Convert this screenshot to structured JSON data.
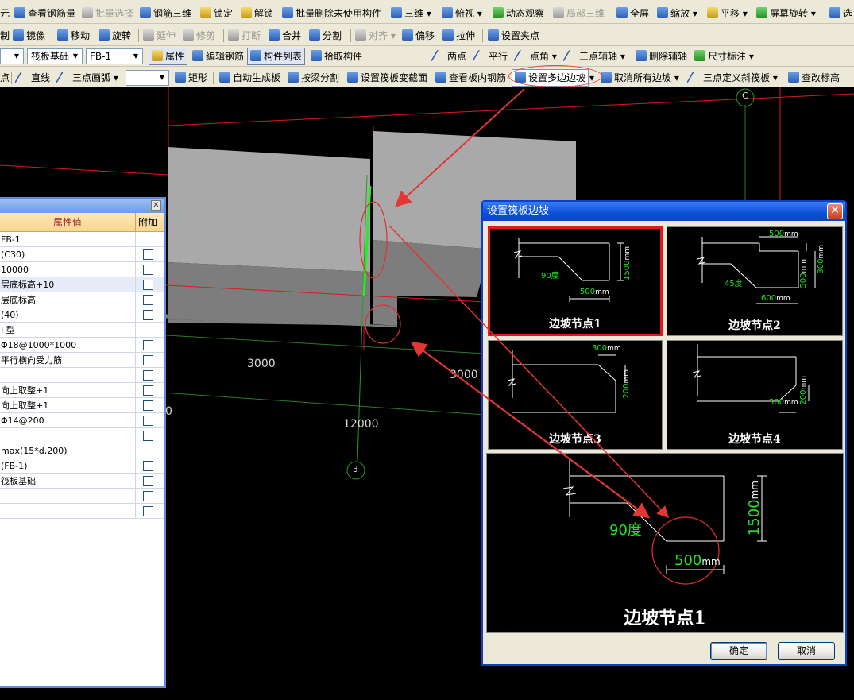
{
  "toolbar": {
    "row1": [
      "元",
      "查看钢筋量",
      "批量选择",
      "钢筋三维",
      "锁定",
      "解锁",
      "批量删除未使用构件",
      "三维",
      "俯视",
      "动态观察",
      "局部三维",
      "全屏",
      "缩放",
      "平移",
      "屏幕旋转",
      "选"
    ],
    "row2": [
      "制",
      "镜像",
      "移动",
      "旋转",
      "延伸",
      "修剪",
      "打断",
      "合并",
      "分割",
      "对齐",
      "偏移",
      "拉伸",
      "设置夹点"
    ],
    "row3": {
      "combo_type": "筏板基础",
      "combo_name": "FB-1",
      "items": [
        "属性",
        "编辑钢筋",
        "构件列表",
        "拾取构件",
        "两点",
        "平行",
        "点角",
        "三点辅轴",
        "删除辅轴",
        "尺寸标注"
      ]
    },
    "row4": [
      "点",
      "直线",
      "三点画弧",
      "矩形",
      "自动生成板",
      "按梁分割",
      "设置筏板变截面",
      "查看板内钢筋",
      "设置多边边坡",
      "取消所有边坡",
      "三点定义斜筏板",
      "查改标高"
    ]
  },
  "canvas": {
    "axis_c": "C",
    "axis_3": "3",
    "dim_3000_left": "3000",
    "dim_3000_right": "3000",
    "dim_12000": "12000",
    "dim_partial": "0"
  },
  "props": {
    "header_value": "属性值",
    "header_add": "附加",
    "rows": [
      {
        "v": "FB-1",
        "cb": false
      },
      {
        "v": "(C30)",
        "cb": true
      },
      {
        "v": "10000",
        "cb": true
      },
      {
        "v": "层底标高+10",
        "cb": true
      },
      {
        "v": "层底标高",
        "cb": true
      },
      {
        "v": "(40)",
        "cb": true
      },
      {
        "v": "I 型",
        "cb": false
      },
      {
        "v": "Φ18@1000*1000",
        "cb": true
      },
      {
        "v": "平行横向受力筋",
        "cb": true
      },
      {
        "v": "",
        "cb": true
      },
      {
        "v": "向上取整+1",
        "cb": true
      },
      {
        "v": "向上取整+1",
        "cb": true
      },
      {
        "v": "Φ14@200",
        "cb": true
      },
      {
        "v": "",
        "cb": true
      },
      {
        "v": "max(15*d,200)",
        "cb": false
      },
      {
        "v": "(FB-1)",
        "cb": true
      },
      {
        "v": "筏板基础",
        "cb": true
      },
      {
        "v": "",
        "cb": true
      },
      {
        "v": "",
        "cb": true
      }
    ]
  },
  "dialog": {
    "title": "设置筏板边坡",
    "options": [
      {
        "caption": "边坡节点1",
        "dim_h": "1500",
        "dim_w": "500",
        "angle": "90度",
        "unit": "mm"
      },
      {
        "caption": "边坡节点2",
        "dim_top": "500",
        "dim_h1": "300",
        "dim_h2": "500",
        "dim_w": "600",
        "angle": "45度",
        "unit": "mm"
      },
      {
        "caption": "边坡节点3",
        "dim_w": "300",
        "dim_h": "200",
        "unit": "mm"
      },
      {
        "caption": "边坡节点4",
        "dim_w": "300",
        "dim_h": "200",
        "unit": "mm"
      }
    ],
    "preview": {
      "caption": "边坡节点1",
      "angle": "90度",
      "dim_w": "500",
      "dim_h": "1500",
      "unit": "mm"
    },
    "ok": "确定",
    "cancel": "取消"
  }
}
